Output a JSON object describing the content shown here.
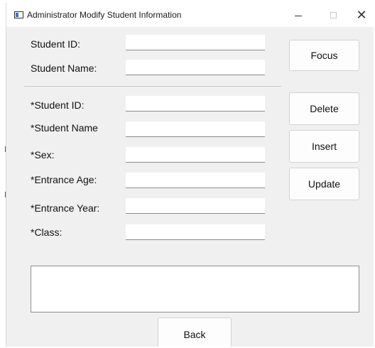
{
  "window": {
    "title": "Administrator Modify Student Information"
  },
  "search_section": {
    "student_id_label": "Student ID:",
    "student_name_label": "Student Name:",
    "student_id_value": "",
    "student_name_value": "",
    "focus_label": "Focus"
  },
  "edit_section": {
    "student_id_label": "*Student ID:",
    "student_name_label": "*Student Name",
    "sex_label": "*Sex:",
    "entrance_age_label": "*Entrance Age:",
    "entrance_year_label": "*Entrance Year:",
    "class_label": "*Class:",
    "student_id_value": "",
    "student_name_value": "",
    "sex_value": "",
    "entrance_age_value": "",
    "entrance_year_value": "",
    "class_value": ""
  },
  "actions": {
    "delete_label": "Delete",
    "insert_label": "Insert",
    "update_label": "Update",
    "back_label": "Back"
  },
  "output": {
    "text": ""
  }
}
